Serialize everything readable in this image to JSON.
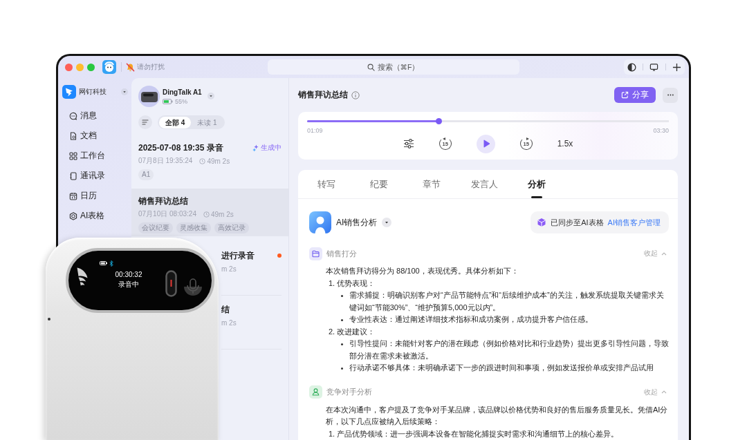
{
  "window": {
    "dnd_label": "请勿打扰",
    "search_placeholder": "搜索（⌘F）"
  },
  "sidebar": {
    "org_name": "网钉科技",
    "items": [
      {
        "kind": "messages",
        "label": "消息",
        "selected": false
      },
      {
        "kind": "docs",
        "label": "文档",
        "selected": false
      },
      {
        "kind": "workbench",
        "label": "工作台",
        "selected": false
      },
      {
        "kind": "contacts",
        "label": "通讯录",
        "selected": false
      },
      {
        "kind": "calendar",
        "label": "日历",
        "selected": false
      },
      {
        "kind": "sheets",
        "label": "AI表格",
        "selected": false
      }
    ]
  },
  "device": {
    "name": "DingTalk A1",
    "battery": "55%"
  },
  "filters": [
    {
      "label": "全部 4",
      "selected": true
    },
    {
      "label": "未读 1",
      "selected": false
    }
  ],
  "recordings": [
    {
      "title": "2025-07-08 19:35 录音",
      "date": "07月8日 19:35:24",
      "duration": "49m 2s",
      "tags": [
        "A1"
      ],
      "status": "生成中",
      "selected": false,
      "unread": false
    },
    {
      "title": "销售拜访总结",
      "date": "07月10日 08:03:24",
      "duration": "49m 2s",
      "tags": [
        "会议纪要",
        "灵感收集",
        "高效记录"
      ],
      "selected": true,
      "unread": false
    },
    {
      "title": "进行录音",
      "duration": "m 2s",
      "selected": false,
      "unread": true
    },
    {
      "title": "结",
      "duration": "m 2s",
      "selected": false,
      "unread": false
    }
  ],
  "detail": {
    "title": "销售拜访总结",
    "share": "分享"
  },
  "player": {
    "level": 0.365,
    "elapsed": "01:09",
    "total": "03:30",
    "playing": false,
    "skip_back": "15",
    "skip_forward": "15",
    "speed": "1.5x"
  },
  "tabs": [
    {
      "label": "转写",
      "selected": false
    },
    {
      "label": "纪要",
      "selected": false
    },
    {
      "label": "章节",
      "selected": false
    },
    {
      "label": "发言人",
      "selected": false
    },
    {
      "label": "分析",
      "selected": true
    }
  ],
  "analysis": {
    "assistant": "AI销售分析",
    "sync_text": "已同步至AI表格",
    "sync_link": "AI销售客户管理",
    "sections": [
      {
        "kind": "score",
        "title": "销售打分",
        "collapse": "收起",
        "blocks": [
          {
            "kind": "paragraph",
            "text": "本次销售拜访得分为 88/100，表现优秀。具体分析如下："
          },
          {
            "kind": "numbered",
            "text": "1. 优势表现：",
            "bullets": [
              "需求捕捉：明确识别客户对“产品节能特点”和“后续维护成本”的关注，触发系统提取关键需求关键词如“节能30%”、“维护预算5,000元以内”。",
              "专业性表达：通过阐述详细技术指标和成功案例，成功提升客户信任感。"
            ]
          },
          {
            "kind": "numbered",
            "text": "2. 改进建议：",
            "bullets": [
              "引导性提问：未能针对客户的潜在顾虑（例如价格对比和行业趋势）提出更多引导性问题，导致部分潜在需求未被激活。",
              "行动承诺不够具体：未明确承诺下一步的跟进时间和事项，例如发送报价单或安排产品试用"
            ]
          }
        ]
      },
      {
        "kind": "competitor",
        "title": "竞争对手分析",
        "collapse": "收起",
        "blocks": [
          {
            "kind": "paragraph",
            "text": "在本次沟通中，客户提及了竞争对手某品牌，该品牌以价格优势和良好的售后服务质量见长。凭借AI分析，以下几点应被纳入后续策略："
          },
          {
            "kind": "numbered",
            "text": "1. 产品优势领域：进一步强调本设备在智能化捕捉实时需求和沟通细节上的核心差异。"
          }
        ]
      }
    ]
  },
  "recorder": {
    "timer": "00:30:32",
    "status": "录音中"
  }
}
